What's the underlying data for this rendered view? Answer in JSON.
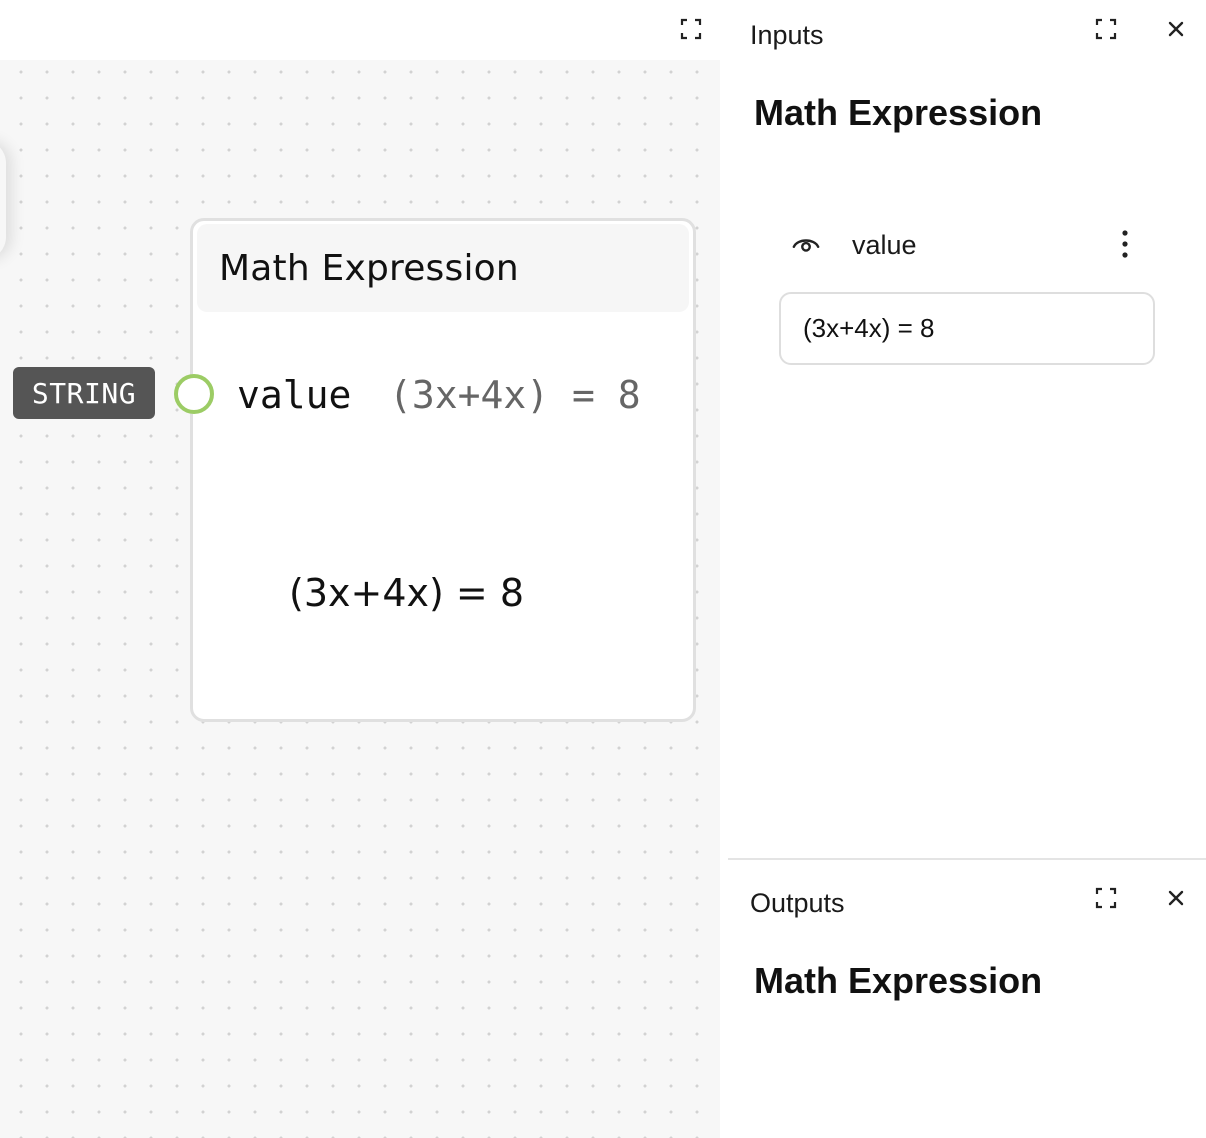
{
  "canvas": {
    "node": {
      "title": "Math Expression",
      "port": {
        "label": "value",
        "value": "(3x+4x) = 8",
        "type": "STRING"
      },
      "preview": "(3x+4x) = 8"
    },
    "icons": {
      "fullscreen": "fullscreen-icon"
    }
  },
  "inputs_panel": {
    "heading": "Inputs",
    "title": "Math Expression",
    "field": {
      "label": "value",
      "value": "(3x+4x) = 8"
    }
  },
  "outputs_panel": {
    "heading": "Outputs",
    "title": "Math Expression"
  },
  "colors": {
    "port_ring": "#9ccc65",
    "badge_bg": "#555555",
    "canvas_bg": "#f7f7f7"
  }
}
